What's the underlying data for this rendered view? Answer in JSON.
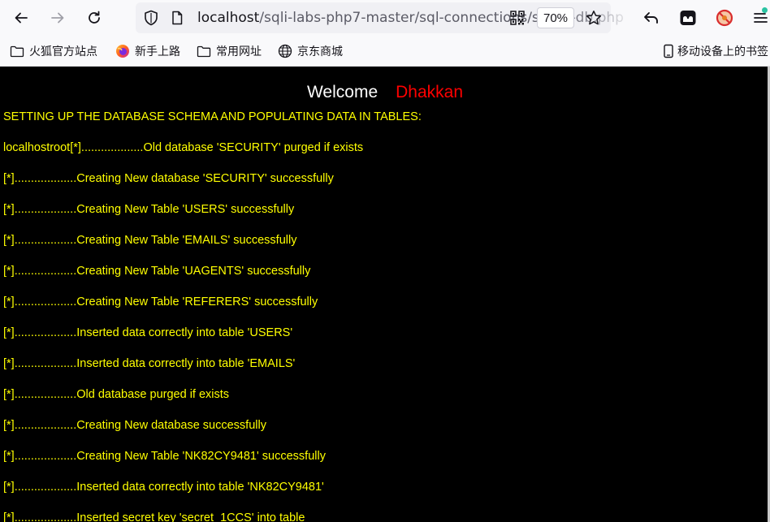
{
  "browser": {
    "url_host": "localhost",
    "url_path": "/sqli-labs-php7-master/sql-connections/setup-db.php",
    "zoom": "70%"
  },
  "bookmarks": [
    {
      "label": "火狐官方站点",
      "icon": "folder-icon"
    },
    {
      "label": "新手上路",
      "icon": "firefox-icon"
    },
    {
      "label": "常用网址",
      "icon": "folder-icon"
    },
    {
      "label": "京东商城",
      "icon": "globe-icon"
    }
  ],
  "mobile_bookmarks": "移动设备上的书签",
  "page": {
    "welcome": "Welcome",
    "name": "Dhakkan",
    "lines": [
      "SETTING UP THE DATABASE SCHEMA AND POPULATING DATA IN TABLES:",
      "localhostroot[*]...................Old database 'SECURITY' purged if exists",
      "[*]...................Creating New database 'SECURITY' successfully",
      "[*]...................Creating New Table 'USERS' successfully",
      "[*]...................Creating New Table 'EMAILS' successfully",
      "[*]...................Creating New Table 'UAGENTS' successfully",
      "[*]...................Creating New Table 'REFERERS' successfully",
      "[*]...................Inserted data correctly into table 'USERS'",
      "[*]...................Inserted data correctly into table 'EMAILS'",
      "[*]...................Old database purged if exists",
      "[*]...................Creating New database successfully",
      "[*]...................Creating New Table 'NK82CY9481' successfully",
      "[*]...................Inserted data correctly into table 'NK82CY9481'",
      "[*]...................Inserted secret key 'secret_1CCS' into table"
    ]
  },
  "colors": {
    "page_background": "#000000",
    "log_text": "#ffff00",
    "name": "#ff0000",
    "welcome": "#ffffff"
  }
}
